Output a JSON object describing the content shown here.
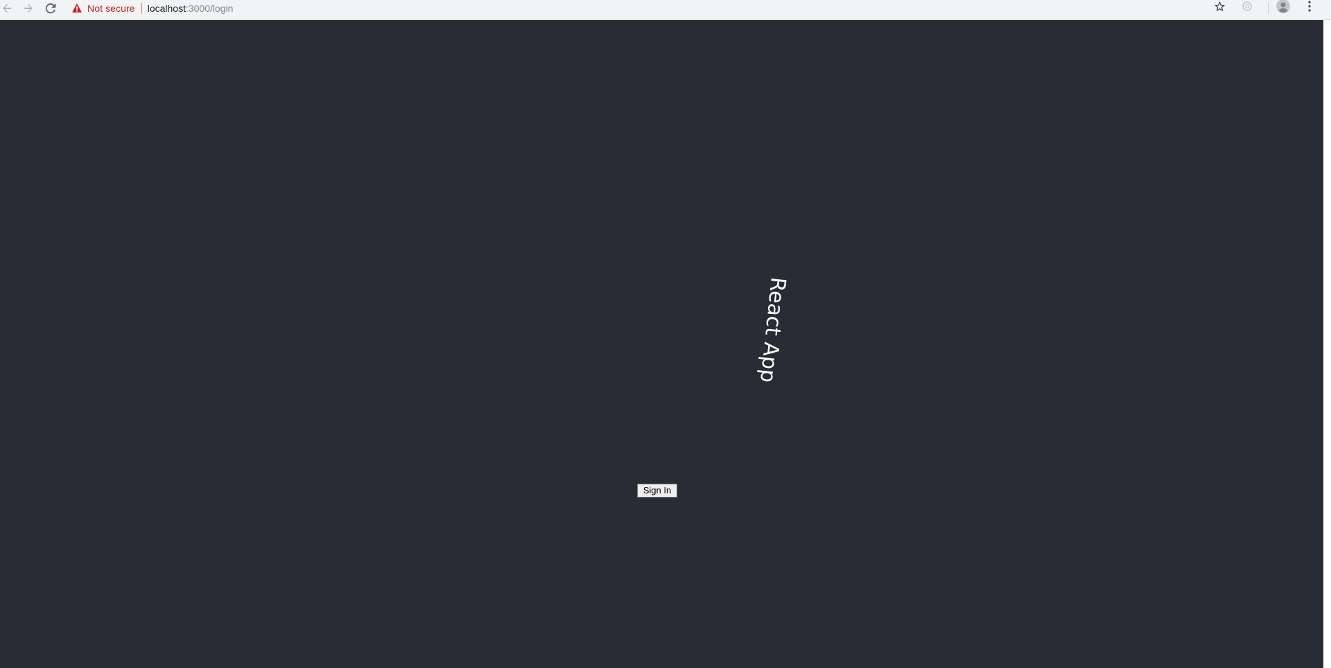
{
  "browser": {
    "security_label": "Not secure",
    "url_host": "localhost",
    "url_path": ":3000/login",
    "icons": {
      "back": "back-arrow-icon",
      "forward": "forward-arrow-icon",
      "reload": "reload-icon",
      "warning": "warning-triangle-icon",
      "bookmark": "star-icon",
      "extension": "extension-icon",
      "profile": "profile-avatar-icon",
      "menu": "kebab-menu-icon"
    },
    "colors": {
      "warning": "#c5221f",
      "toolbar": "#f1f3f4"
    }
  },
  "app": {
    "title": "React App",
    "signin_label": "Sign In",
    "colors": {
      "background": "#282c34",
      "title_text": "#ffffff"
    }
  }
}
